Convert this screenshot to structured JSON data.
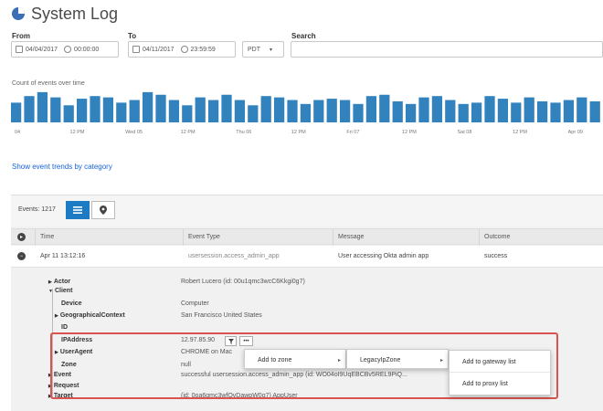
{
  "header": {
    "title": "System Log",
    "icon": "pie-chart-icon"
  },
  "filters": {
    "from_label": "From",
    "from_date": "04/04/2017",
    "from_time": "00:00:00",
    "to_label": "To",
    "to_date": "04/11/2017",
    "to_time": "23:59:59",
    "timezone": "PDT",
    "search_label": "Search",
    "search_value": ""
  },
  "chart": {
    "label": "Count of events over time",
    "bar_color": "#3182bd",
    "values": [
      15,
      20,
      23,
      19,
      13,
      18,
      20,
      19,
      15,
      17,
      23,
      21,
      17,
      13,
      19,
      17,
      21,
      17,
      13,
      20,
      19,
      17,
      14,
      17,
      18,
      17,
      14,
      20,
      21,
      16,
      14,
      19,
      20,
      17,
      14,
      15,
      20,
      18,
      15,
      19,
      16,
      15,
      17,
      19,
      16
    ],
    "ymax": 25,
    "tick_labels": [
      "04",
      "12 PM",
      "Wed 05",
      "12 PM",
      "Thu 06",
      "12 PM",
      "Fri 07",
      "12 PM",
      "Sat 08",
      "12 PM",
      "Apr 09"
    ]
  },
  "trend_link": "Show event trends by category",
  "events": {
    "count_label": "Events: 1217",
    "list_view_icon": "list-icon",
    "map_view_icon": "map-pin-icon"
  },
  "table": {
    "columns": [
      "Time",
      "Event Type",
      "Message",
      "Outcome"
    ],
    "row": {
      "time": "Apr 11 13:12:16",
      "event_type": "usersession.access_admin_app",
      "message": "User accessing Okta admin app",
      "outcome": "success"
    }
  },
  "details": {
    "actor_label": "Actor",
    "actor_value": "Robert Lucero (id: 00u1qmc3wcC6Kkgi0g7)",
    "client_label": "Client",
    "device_label": "Device",
    "device_value": "Computer",
    "geo_label": "GeographicalContext",
    "geo_value": "San Francisco United States",
    "id_label": "ID",
    "ip_label": "IPAddress",
    "ip_value": "12.97.85.90",
    "ua_label": "UserAgent",
    "ua_value": "CHROME on Mac",
    "zone_label": "Zone",
    "zone_value": "null",
    "event_label": "Event",
    "event_value": "successful usersession.access_admin_app (id: WO04oI9UqEBCBv5REL9PiQ...",
    "request_label": "Request",
    "target_label": "Target",
    "target_value": "(id: 0oa6gmc3wfOvDawpW0g7) AppUser"
  },
  "context_menu": {
    "filter_icon": "filter-icon",
    "more_label": "•••",
    "level1": [
      "Add to zone"
    ],
    "level2": [
      "LegacyIpZone"
    ],
    "level3": [
      "Add to gateway list",
      "Add to proxy list"
    ]
  },
  "colors": {
    "accent": "#1d7bc4",
    "link": "#1662dd",
    "highlight": "#d9534f"
  }
}
